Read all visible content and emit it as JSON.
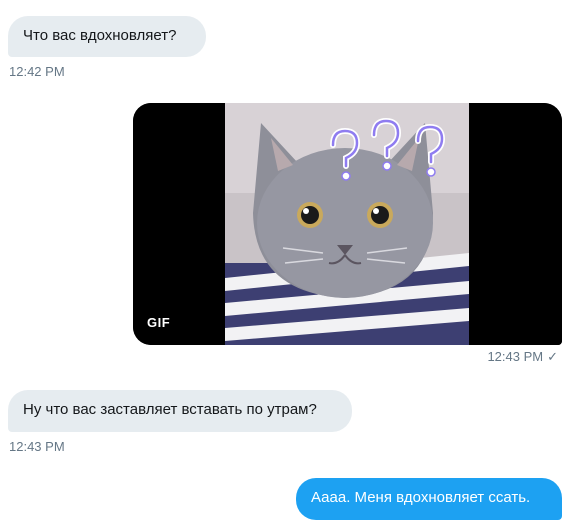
{
  "conversation": {
    "messages": [
      {
        "direction": "incoming",
        "text": "Что вас вдохновляет?",
        "timestamp": "12:42 PM"
      },
      {
        "direction": "outgoing",
        "media": {
          "type": "gif",
          "badge": "GIF",
          "subject": "grey-cat-question-marks"
        },
        "timestamp": "12:43 PM",
        "status_icon": "checkmark-icon"
      },
      {
        "direction": "incoming",
        "text": "Ну что вас заставляет вставать по утрам?",
        "timestamp": "12:43 PM"
      },
      {
        "direction": "outgoing",
        "text": "Аааа. Меня вдохновляет ссать."
      }
    ]
  },
  "colors": {
    "incoming_bubble": "#e6ecf0",
    "outgoing_bubble": "#1da1f2",
    "timestamp": "#657786",
    "text": "#14171a"
  }
}
